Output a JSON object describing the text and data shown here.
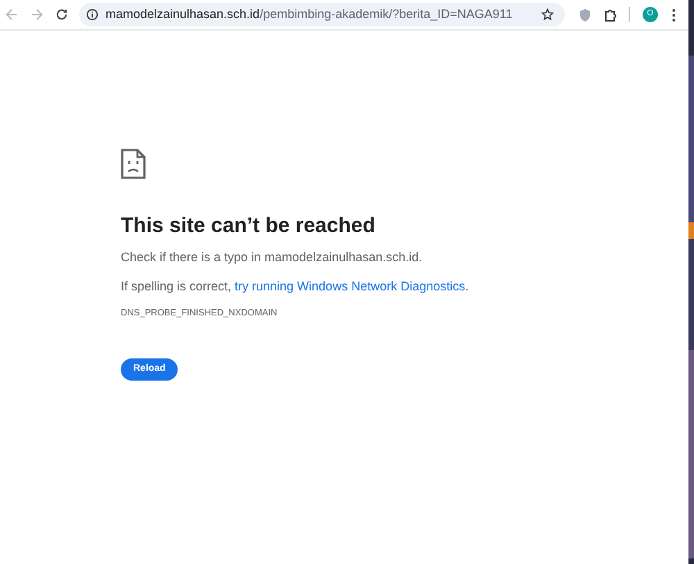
{
  "toolbar": {
    "url_host": "mamodelzainulhasan.sch.id",
    "url_path": "/pembimbing-akademik/?berita_ID=NAGA911",
    "profile_initial": "O",
    "bookmarked": false
  },
  "error_page": {
    "title": "This site can’t be reached",
    "message": "Check if there is a typo in mamodelzainulhasan.sch.id.",
    "suggestion_text": "If spelling is correct, ",
    "suggestion_link": "try running Windows Network Diagnostics",
    "suggestion_end": ".",
    "error_code": "DNS_PROBE_FINISHED_NXDOMAIN",
    "button": "Reload"
  }
}
